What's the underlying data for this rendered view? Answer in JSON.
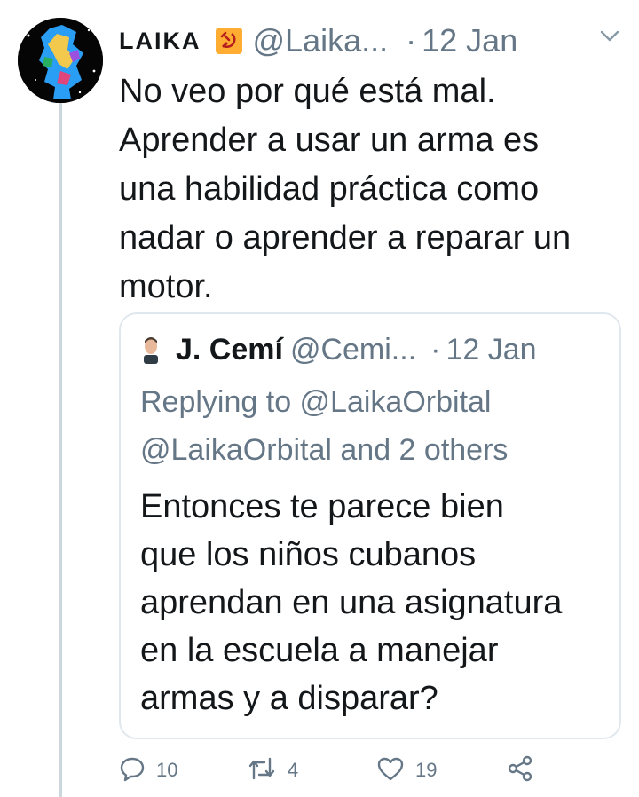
{
  "tweet": {
    "author_name": "LAIKA",
    "author_flag_icon": "hammer-and-sickle-icon",
    "author_handle": "@Laika...",
    "separator": "·",
    "date": "12 Jan",
    "text_lines": [
      "No veo por qué está mal.",
      "Aprender a usar un arma es",
      "una habilidad práctica como",
      "nadar o aprender a reparar un",
      "motor."
    ]
  },
  "quoted_tweet": {
    "author_name": "J. Cemí",
    "author_handle": "@Cemi...",
    "separator": "·",
    "date": "12 Jan",
    "replying_lines": [
      "Replying to @LaikaOrbital",
      "@LaikaOrbital and 2 others"
    ],
    "text_lines": [
      "Entonces te parece bien",
      "que los niños cubanos",
      "aprendan en una asignatura",
      "en la escuela a manejar",
      "armas y a disparar?"
    ]
  },
  "actions": {
    "replies": "10",
    "retweets": "4",
    "likes": "19"
  },
  "colors": {
    "text": "#14171a",
    "secondary": "#657786",
    "border": "#e1e8ed",
    "thread_line": "#ccd6dd",
    "flag_bg": "#ffac33"
  }
}
